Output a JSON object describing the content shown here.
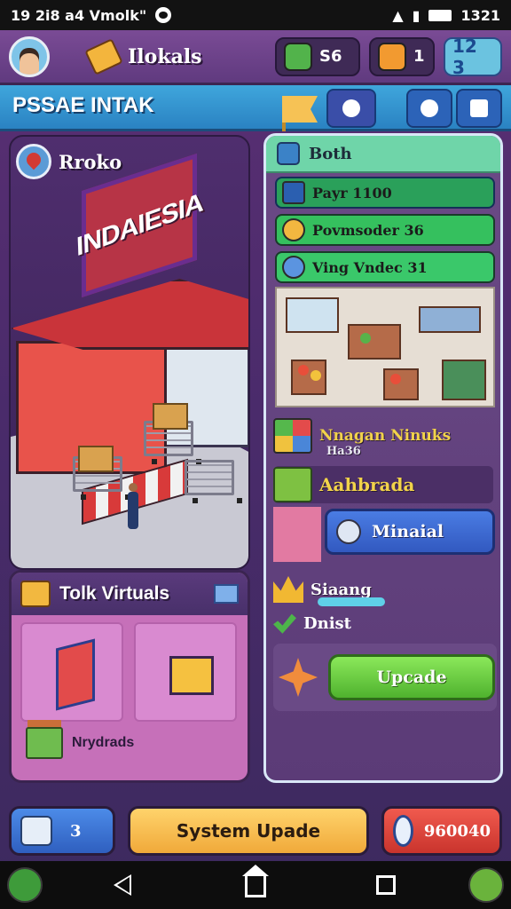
{
  "status_bar": {
    "time_text": "19 2i8 a4 Vmolk\"",
    "clock": "1321"
  },
  "header": {
    "player_name": "Ilokals",
    "cash": "S6",
    "boxes": "1",
    "gems": "12 3"
  },
  "banner": {
    "title": "PSSAE INTAK"
  },
  "store": {
    "location_label": "Rroko",
    "sign_text": "INDAIESIA"
  },
  "virtual_panel": {
    "title": "Tolk Virtuals",
    "footer_label": "Nrydrads"
  },
  "right_panel": {
    "header": "Both",
    "stats": [
      "Payr 1100",
      "Povmsoder 36",
      "Ving Vndec 31"
    ],
    "row1_title": "Nnagan Ninuks",
    "row1_sub": "Ha36",
    "row2_label": "Aahbrada",
    "mineral_button": "Minaial",
    "row3_label": "Siaang",
    "row4_label": "Dnist",
    "upgrade_button": "Upcade"
  },
  "bottom_bar": {
    "left_count": "3",
    "system_update": "System Upade",
    "right_value": "960040"
  },
  "colors": {
    "accent_green": "#4fb22e",
    "accent_blue": "#3259c0",
    "panel_purple": "#5b3b77"
  }
}
